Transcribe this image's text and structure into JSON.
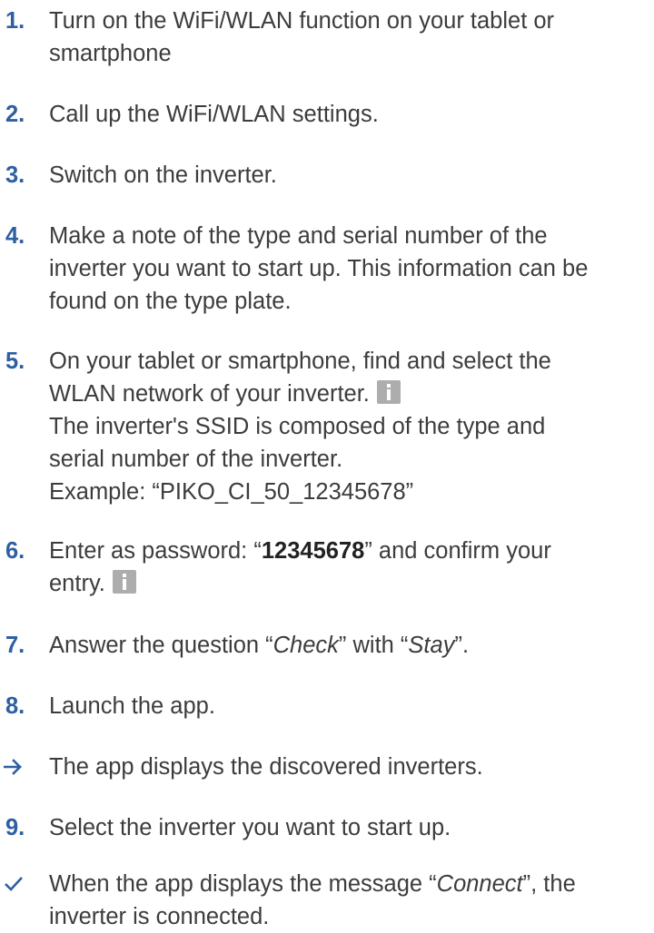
{
  "colors": {
    "accent": "#2e5fa1",
    "text": "#3c3c3c",
    "info_icon": "#adadad"
  },
  "steps": [
    {
      "marker": "1.",
      "lines": [
        "Turn on the WiFi/WLAN function on your tablet or",
        "smartphone"
      ]
    },
    {
      "marker": "2.",
      "lines": [
        "Call up the WiFi/WLAN settings."
      ]
    },
    {
      "marker": "3.",
      "lines": [
        "Switch on the inverter."
      ]
    },
    {
      "marker": "4.",
      "lines": [
        "Make a note of the type and serial number of the",
        "inverter you want to start up. This information can be",
        "found on the type plate."
      ]
    },
    {
      "marker": "5.",
      "lines": [
        "On your tablet or smartphone, find and select the",
        "WLAN network of your inverter."
      ],
      "note_lines": [
        "The inverter's SSID is composed of the type and",
        "serial number of the inverter.",
        "Example: “PIKO_CI_50_12345678”"
      ],
      "icon": "info-icon"
    },
    {
      "marker": "6.",
      "prefix": "Enter as password: “",
      "password": "12345678",
      "suffix": "” and confirm your",
      "line2": "entry.",
      "icon": "info-icon"
    },
    {
      "marker": "7.",
      "prefix": "Answer the question “",
      "check": "Check",
      "middle": "” with “",
      "stay": "Stay",
      "suffix": "”."
    },
    {
      "marker": "8.",
      "lines": [
        "Launch the app."
      ]
    },
    {
      "marker_icon": "arrow-right-icon",
      "lines": [
        "The app displays the discovered inverters."
      ]
    },
    {
      "marker": "9.",
      "lines": [
        "Select the inverter you want to start up."
      ]
    },
    {
      "marker_icon": "checkmark-icon",
      "prefix": "When the app displays the message “",
      "connect": "Connect",
      "suffix": "”, the",
      "line2": "inverter is connected."
    }
  ]
}
